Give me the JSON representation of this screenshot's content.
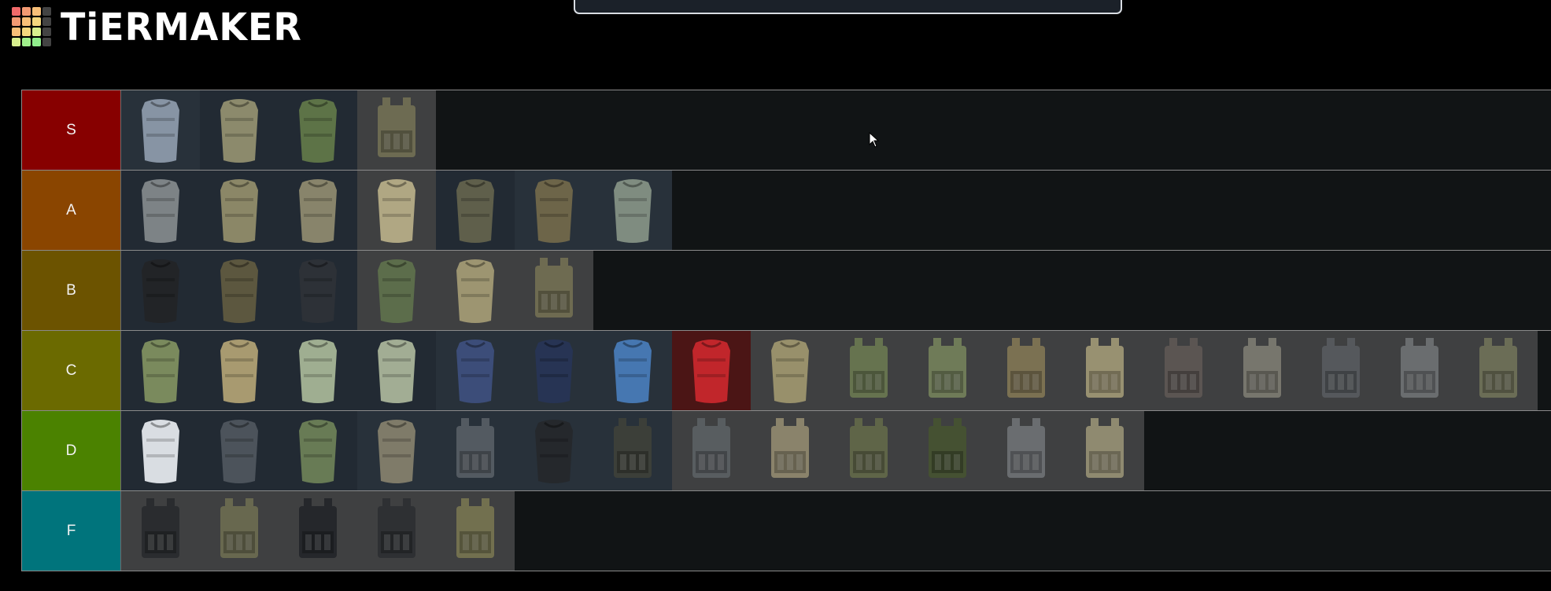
{
  "brand": {
    "name": "TiERMAKER",
    "grid_colors": [
      "#f16a6a",
      "#f39a73",
      "#f8bf78",
      "#434343",
      "#f39a73",
      "#f8bf78",
      "#f5d77e",
      "#434343",
      "#f8bf78",
      "#f5d77e",
      "#d8ef8e",
      "#434343",
      "#d8ef8e",
      "#a1f08b",
      "#90ed8b",
      "#434343"
    ]
  },
  "search": {
    "value": ""
  },
  "tiers": [
    {
      "label": "S",
      "color": "#870000",
      "items": [
        {
          "name": "gray-armor-vest-icon",
          "fill": "#8794a4",
          "bg": "alt"
        },
        {
          "name": "multicam-armor-vest-icon",
          "fill": "#8c8a6c",
          "bg": "base"
        },
        {
          "name": "green-armor-vest-icon",
          "fill": "#5d7347",
          "bg": "base"
        },
        {
          "name": "multicam-plate-carrier-icon",
          "fill": "#6d6b52",
          "bg": "gray"
        }
      ]
    },
    {
      "label": "A",
      "color": "#8a4500",
      "items": [
        {
          "name": "gray-armor-vest-icon",
          "fill": "#7d8386",
          "bg": "base"
        },
        {
          "name": "multicam-armor-vest-icon",
          "fill": "#8b8767",
          "bg": "base"
        },
        {
          "name": "multicam-armor-vest-icon",
          "fill": "#88846b",
          "bg": "base"
        },
        {
          "name": "tan-armor-vest-icon",
          "fill": "#b0a783",
          "bg": "gray"
        },
        {
          "name": "dark-multicam-armor-vest-icon",
          "fill": "#5f5f4b",
          "bg": "base"
        },
        {
          "name": "olive-armor-vest-icon",
          "fill": "#6d6549",
          "bg": "alt"
        },
        {
          "name": "green-camo-armor-vest-icon",
          "fill": "#7f8c80",
          "bg": "alt"
        }
      ]
    },
    {
      "label": "B",
      "color": "#6c5300",
      "items": [
        {
          "name": "black-armor-vest-icon",
          "fill": "#222427",
          "bg": "base"
        },
        {
          "name": "olive-armor-vest-icon",
          "fill": "#5c573f",
          "bg": "base"
        },
        {
          "name": "black-armor-vest-icon",
          "fill": "#2d3137",
          "bg": "base"
        },
        {
          "name": "green-camo-armor-vest-icon",
          "fill": "#5c6d4b",
          "bg": "gray"
        },
        {
          "name": "tan-armor-vest-icon",
          "fill": "#9d9571",
          "bg": "gray"
        },
        {
          "name": "multicam-plate-carrier-icon",
          "fill": "#6e6b51",
          "bg": "gray"
        }
      ]
    },
    {
      "label": "C",
      "color": "#6b6a00",
      "items": [
        {
          "name": "green-camo-armor-vest-icon",
          "fill": "#7a8a5d",
          "bg": "base"
        },
        {
          "name": "multicam-armor-vest-icon",
          "fill": "#a89a70",
          "bg": "base"
        },
        {
          "name": "pale-camo-armor-vest-icon",
          "fill": "#9fae91",
          "bg": "base"
        },
        {
          "name": "pale-camo-armor-vest-icon",
          "fill": "#a2ad94",
          "bg": "base"
        },
        {
          "name": "blue-armor-vest-icon",
          "fill": "#3c4d79",
          "bg": "alt"
        },
        {
          "name": "press-armor-vest-icon",
          "fill": "#273454",
          "bg": "alt"
        },
        {
          "name": "untar-armor-vest-icon",
          "fill": "#4677b1",
          "bg": "alt"
        },
        {
          "name": "red-armor-vest-icon",
          "fill": "#c1262b",
          "bg": "red"
        },
        {
          "name": "tan-armor-vest-icon",
          "fill": "#98906b",
          "bg": "gray"
        },
        {
          "name": "green-plate-carrier-icon",
          "fill": "#66734f",
          "bg": "gray"
        },
        {
          "name": "green-plate-carrier-icon",
          "fill": "#6f7b58",
          "bg": "gray"
        },
        {
          "name": "multicam-plate-carrier-icon",
          "fill": "#7b7152",
          "bg": "gray"
        },
        {
          "name": "tan-plate-carrier-icon",
          "fill": "#989171",
          "bg": "gray"
        },
        {
          "name": "dark-plate-carrier-icon",
          "fill": "#5b5552",
          "bg": "gray"
        },
        {
          "name": "gray-plate-carrier-icon",
          "fill": "#77766d",
          "bg": "gray"
        },
        {
          "name": "gray-plate-carrier-icon",
          "fill": "#55585c",
          "bg": "gray"
        },
        {
          "name": "gray-plate-carrier-icon",
          "fill": "#6a6d6f",
          "bg": "gray"
        },
        {
          "name": "multicam-plate-carrier-icon",
          "fill": "#6b6d56",
          "bg": "gray"
        }
      ]
    },
    {
      "label": "D",
      "color": "#4b8200",
      "items": [
        {
          "name": "white-armor-vest-icon",
          "fill": "#d9dde2",
          "bg": "base"
        },
        {
          "name": "gray-armor-vest-icon",
          "fill": "#4c535b",
          "bg": "base"
        },
        {
          "name": "green-camo-armor-vest-icon",
          "fill": "#687b55",
          "bg": "base"
        },
        {
          "name": "usec-armor-vest-icon",
          "fill": "#7f7b69",
          "bg": "alt"
        },
        {
          "name": "gray-plate-carrier-icon",
          "fill": "#535a61",
          "bg": "alt"
        },
        {
          "name": "black-armor-vest-icon",
          "fill": "#25282c",
          "bg": "alt"
        },
        {
          "name": "dark-plate-carrier-icon",
          "fill": "#3c3f39",
          "bg": "alt"
        },
        {
          "name": "gray-plate-carrier-icon",
          "fill": "#585d60",
          "bg": "gray"
        },
        {
          "name": "tan-plate-carrier-icon",
          "fill": "#8a836b",
          "bg": "gray"
        },
        {
          "name": "green-plate-carrier-icon",
          "fill": "#5f6548",
          "bg": "gray"
        },
        {
          "name": "green-plate-carrier-icon",
          "fill": "#455132",
          "bg": "gray"
        },
        {
          "name": "gray-plate-carrier-icon",
          "fill": "#6a6d70",
          "bg": "gray"
        },
        {
          "name": "tan-plate-carrier-icon",
          "fill": "#8f8a70",
          "bg": "gray"
        }
      ]
    },
    {
      "label": "F",
      "color": "#00747c",
      "items": [
        {
          "name": "black-plate-carrier-icon",
          "fill": "#2a2c2f",
          "bg": "gray"
        },
        {
          "name": "multicam-plate-carrier-icon",
          "fill": "#68684f",
          "bg": "gray"
        },
        {
          "name": "black-plate-carrier-icon",
          "fill": "#25272b",
          "bg": "gray"
        },
        {
          "name": "black-plate-carrier-icon",
          "fill": "#2e3033",
          "bg": "gray"
        },
        {
          "name": "multicam-plate-carrier-icon",
          "fill": "#72704f",
          "bg": "gray"
        }
      ]
    }
  ]
}
